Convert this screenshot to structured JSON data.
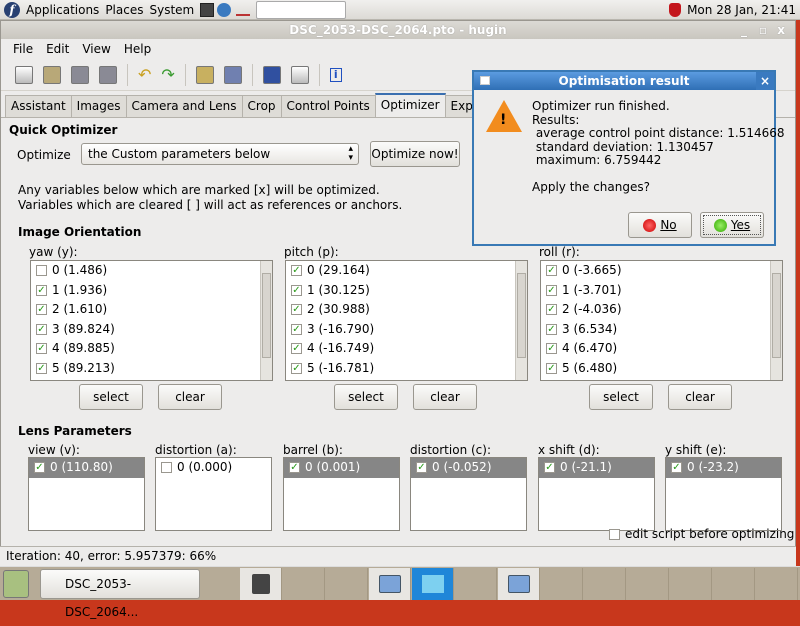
{
  "panel": {
    "menus": [
      "Applications",
      "Places",
      "System"
    ],
    "clock": "Mon 28 Jan, 21:41"
  },
  "window": {
    "title": "DSC_2053-DSC_2064.pto - hugin"
  },
  "menu": [
    "File",
    "Edit",
    "View",
    "Help"
  ],
  "toolbar": [
    "new-file-icon",
    "open-folder-icon",
    "save-icon",
    "save-as-icon",
    "undo-icon",
    "redo-icon",
    "preview-icon",
    "fast-preview-icon",
    "panorama-icon",
    "list-icon",
    "info-icon"
  ],
  "tabs": [
    "Assistant",
    "Images",
    "Camera and Lens",
    "Crop",
    "Control Points",
    "Optimizer",
    "Exposure"
  ],
  "active_tab": "Optimizer",
  "optimizer": {
    "quick_title": "Quick Optimizer",
    "optimize_label": "Optimize",
    "optimize_value": "the Custom parameters below",
    "optimize_now": "Optimize now!",
    "note1": "Any variables below which are marked [x] will be optimized.",
    "note2": "Variables which are cleared [ ] will act as references or anchors.",
    "orientation_title": "Image Orientation",
    "select": "select",
    "clear": "clear",
    "columns": [
      {
        "label": "yaw (y):",
        "items": [
          {
            "t": "0 (1.486)",
            "c": false
          },
          {
            "t": "1 (1.936)",
            "c": true
          },
          {
            "t": "2 (1.610)",
            "c": true
          },
          {
            "t": "3 (89.824)",
            "c": true
          },
          {
            "t": "4 (89.885)",
            "c": true
          },
          {
            "t": "5 (89.213)",
            "c": true
          }
        ]
      },
      {
        "label": "pitch (p):",
        "items": [
          {
            "t": "0 (29.164)",
            "c": true
          },
          {
            "t": "1 (30.125)",
            "c": true
          },
          {
            "t": "2 (30.988)",
            "c": true
          },
          {
            "t": "3 (-16.790)",
            "c": true
          },
          {
            "t": "4 (-16.749)",
            "c": true
          },
          {
            "t": "5 (-16.781)",
            "c": true
          }
        ]
      },
      {
        "label": "roll (r):",
        "items": [
          {
            "t": "0 (-3.665)",
            "c": true
          },
          {
            "t": "1 (-3.701)",
            "c": true
          },
          {
            "t": "2 (-4.036)",
            "c": true
          },
          {
            "t": "3 (6.534)",
            "c": true
          },
          {
            "t": "4 (6.470)",
            "c": true
          },
          {
            "t": "5 (6.480)",
            "c": true
          }
        ]
      }
    ],
    "lens_title": "Lens Parameters",
    "lens": [
      {
        "label": "view (v):",
        "item": "0 (110.80)",
        "c": true
      },
      {
        "label": "distortion (a):",
        "item": "0 (0.000)",
        "c": false
      },
      {
        "label": "barrel (b):",
        "item": "0 (0.001)",
        "c": true
      },
      {
        "label": "distortion (c):",
        "item": "0 (-0.052)",
        "c": true
      },
      {
        "label": "x shift (d):",
        "item": "0 (-21.1)",
        "c": true
      },
      {
        "label": "y shift (e):",
        "item": "0 (-23.2)",
        "c": true
      }
    ],
    "edit_script": "edit script before optimizing"
  },
  "status": "Iteration: 40, error: 5.957379: 66%",
  "taskbar": {
    "task": "DSC_2053-DSC_2064..."
  },
  "dialog": {
    "title": "Optimisation result",
    "lines": [
      "Optimizer run finished.",
      "Results:",
      " average control point distance: 1.514668",
      " standard deviation: 1.130457",
      " maximum: 6.759442"
    ],
    "question": "Apply the changes?",
    "no": "No",
    "yes": "Yes"
  }
}
